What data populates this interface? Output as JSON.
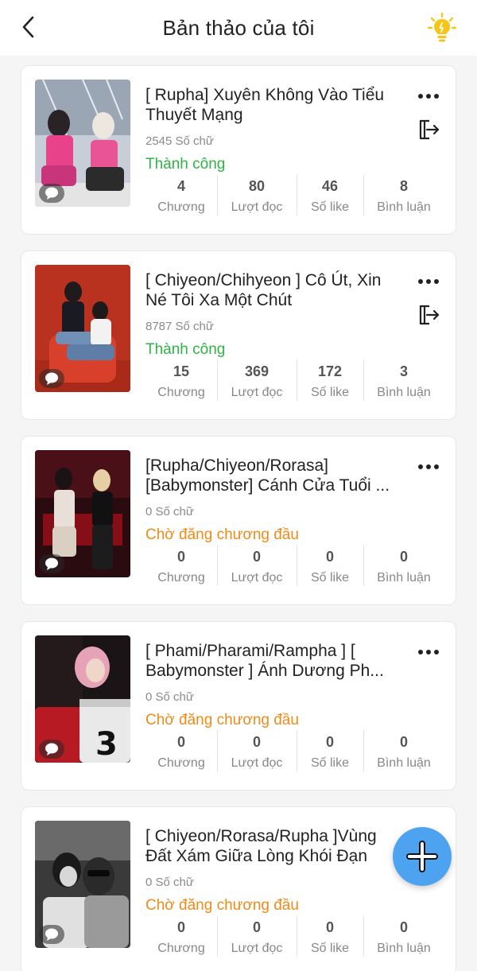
{
  "header": {
    "title": "Bản thảo của tôi",
    "back_icon": "chevron-left-icon",
    "tip_icon": "lightbulb-icon"
  },
  "colors": {
    "success": "#2fb344",
    "pending": "#f08a19",
    "fab": "#4ea3f0",
    "bulb": "#f5c518"
  },
  "stat_labels": {
    "chapters": "Chương",
    "reads": "Lượt đọc",
    "likes": "Số like",
    "comments": "Bình luận"
  },
  "drafts": [
    {
      "title": "[ Rupha] Xuyên Không Vào Tiểu Thuyết Mạng",
      "word_count": "2545 Số chữ",
      "status": "Thành công",
      "chapters": "4",
      "reads": "80",
      "likes": "46",
      "comments": "8"
    },
    {
      "title": "[ Chiyeon/Chihyeon ] Cô Út, Xin Né Tôi Xa Một Chút",
      "word_count": "8787 Số chữ",
      "status": "Thành công",
      "chapters": "15",
      "reads": "369",
      "likes": "172",
      "comments": "3"
    },
    {
      "title": "[Rupha/Chiyeon/Rorasa] [Babymonster] Cánh Cửa Tuổi ...",
      "word_count": "0 Số chữ",
      "status": "Chờ đăng chương đầu",
      "chapters": "0",
      "reads": "0",
      "likes": "0",
      "comments": "0"
    },
    {
      "title": "[ Phami/Pharami/Rampha ] [ Babymonster ] Ánh Dương Ph...",
      "word_count": "0 Số chữ",
      "status": "Chờ đăng chương đầu",
      "chapters": "0",
      "reads": "0",
      "likes": "0",
      "comments": "0"
    },
    {
      "title": "[ Chiyeon/Rorasa/Rupha ]Vùng Đất Xám Giữa Lòng Khói Đạn",
      "word_count": "0 Số chữ",
      "status": "Chờ đăng chương đầu",
      "chapters": "0",
      "reads": "0",
      "likes": "0",
      "comments": "0"
    }
  ]
}
